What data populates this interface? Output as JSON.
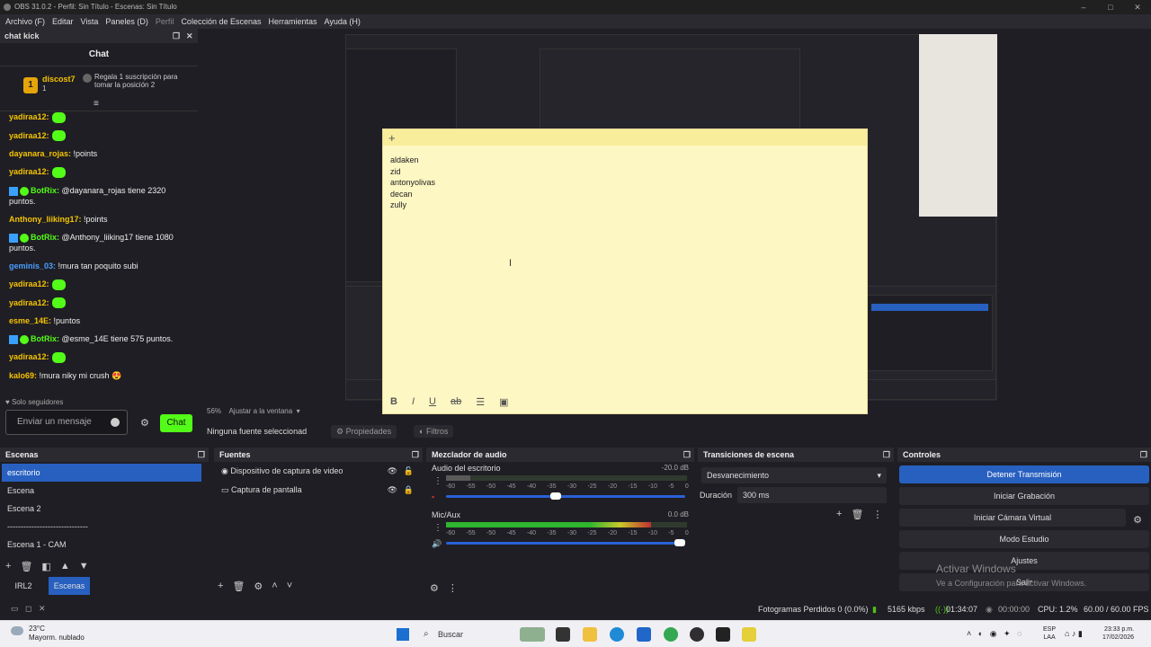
{
  "titlebar": {
    "title": "OBS 31.0.2 - Perfil: Sin Título - Escenas: Sin Título"
  },
  "menu": [
    "Archivo (F)",
    "Editar",
    "Vista",
    "Paneles (D)",
    "Perfil",
    "Colección de Escenas",
    "Herramientas",
    "Ayuda (H)"
  ],
  "chat": {
    "dock_title": "chat kick",
    "title": "Chat",
    "pinned": {
      "rank": "1",
      "user": "discost7",
      "count": "1",
      "text": "Regala 1 suscripción para tomar la posición 2"
    },
    "messages": [
      {
        "user": "yadiraa12:",
        "text": "",
        "emote": true,
        "bot": false,
        "ucolor": "#f5c400"
      },
      {
        "user": "yadiraa12:",
        "text": "",
        "emote": true,
        "bot": false,
        "ucolor": "#f5c400"
      },
      {
        "user": "dayanara_rojas:",
        "text": " !points",
        "emote": false,
        "bot": false,
        "ucolor": "#f5c400"
      },
      {
        "user": "yadiraa12:",
        "text": "",
        "emote": true,
        "bot": false,
        "ucolor": "#f5c400"
      },
      {
        "user": "BotRix:",
        "text": " @dayanara_rojas tiene 2320 puntos.",
        "emote": false,
        "bot": true,
        "ucolor": "#53fc18"
      },
      {
        "user": "Anthony_liiking17:",
        "text": " !points",
        "emote": false,
        "bot": false,
        "ucolor": "#f5c400"
      },
      {
        "user": "BotRix:",
        "text": " @Anthony_liiking17 tiene 1080 puntos.",
        "emote": false,
        "bot": true,
        "ucolor": "#53fc18"
      },
      {
        "user": "geminis_03:",
        "text": " !mura tan poquito subi",
        "emote": false,
        "bot": false,
        "ucolor": "#4a9eff"
      },
      {
        "user": "yadiraa12:",
        "text": "",
        "emote": true,
        "bot": false,
        "ucolor": "#f5c400"
      },
      {
        "user": "yadiraa12:",
        "text": "",
        "emote": true,
        "bot": false,
        "ucolor": "#f5c400"
      },
      {
        "user": "esme_14E:",
        "text": " !puntos",
        "emote": false,
        "bot": false,
        "ucolor": "#f5c400"
      },
      {
        "user": "BotRix:",
        "text": " @esme_14E tiene 575 puntos.",
        "emote": false,
        "bot": true,
        "ucolor": "#53fc18"
      },
      {
        "user": "yadiraa12:",
        "text": "",
        "emote": true,
        "bot": false,
        "ucolor": "#f5c400"
      },
      {
        "user": "kalo69:",
        "text": " !mura niky mi crush 😍",
        "emote": false,
        "bot": false,
        "ucolor": "#f5c400"
      }
    ],
    "followers_only": "♥ Solo seguidores",
    "input_placeholder": "Enviar un mensaje",
    "send_label": "Chat"
  },
  "note": {
    "lines": [
      "aldaken",
      "zid",
      "antonyolivas",
      "decan",
      "zully"
    ]
  },
  "preview": {
    "zoom": "56%",
    "zoom_mode": "Ajustar a la ventana"
  },
  "props": {
    "no_source": "Ninguna fuente seleccionad",
    "properties": "Propiedades",
    "filters": "Filtros"
  },
  "scenes": {
    "title": "Escenas",
    "items": [
      "escritorio",
      "Escena",
      "Escena 2",
      "------------------------------",
      "Escena 1 - CAM"
    ],
    "selected": 0
  },
  "scene_tabs": [
    "IRL2",
    "Escenas"
  ],
  "sources": {
    "title": "Fuentes",
    "items": [
      "Dispositivo de captura de video",
      "Captura de pantalla"
    ]
  },
  "mixer": {
    "title": "Mezclador de audio",
    "channels": [
      {
        "name": "Audio del escritorio",
        "db": "-20.0 dB",
        "level": 0.1,
        "vol": 0.48
      },
      {
        "name": "Mic/Aux",
        "db": "0.0 dB",
        "level": 0.85,
        "vol": 1.0
      }
    ],
    "scale": [
      "-60",
      "-55",
      "-50",
      "-45",
      "-40",
      "-35",
      "-30",
      "-25",
      "-20",
      "-15",
      "-10",
      "-5",
      "0"
    ]
  },
  "transitions": {
    "title": "Transiciones de escena",
    "type": "Desvanecimiento",
    "duration_label": "Duración",
    "duration": "300 ms"
  },
  "controls": {
    "title": "Controles",
    "buttons": [
      "Detener Transmisión",
      "Iniciar Grabación",
      "Iniciar Cámara Virtual",
      "Modo Estudio",
      "Ajustes",
      "Salir"
    ]
  },
  "watermark": {
    "line1": "Activar Windows",
    "line2": "Ve a Configuración para activar Windows."
  },
  "status": {
    "dropped": "Fotogramas Perdidos 0 (0.0%)",
    "kbps": "5165 kbps",
    "stream_time": "01:34:07",
    "rec_time": "00:00:00",
    "cpu": "CPU: 1.2%",
    "fps": "60.00 / 60.00 FPS"
  },
  "taskbar": {
    "temp": "23°C",
    "weather": "Mayorm. nublado",
    "search": "Buscar",
    "lang1": "ESP",
    "lang2": "LAA",
    "time": "23:33 p.m.",
    "date": "17/02/2026"
  }
}
